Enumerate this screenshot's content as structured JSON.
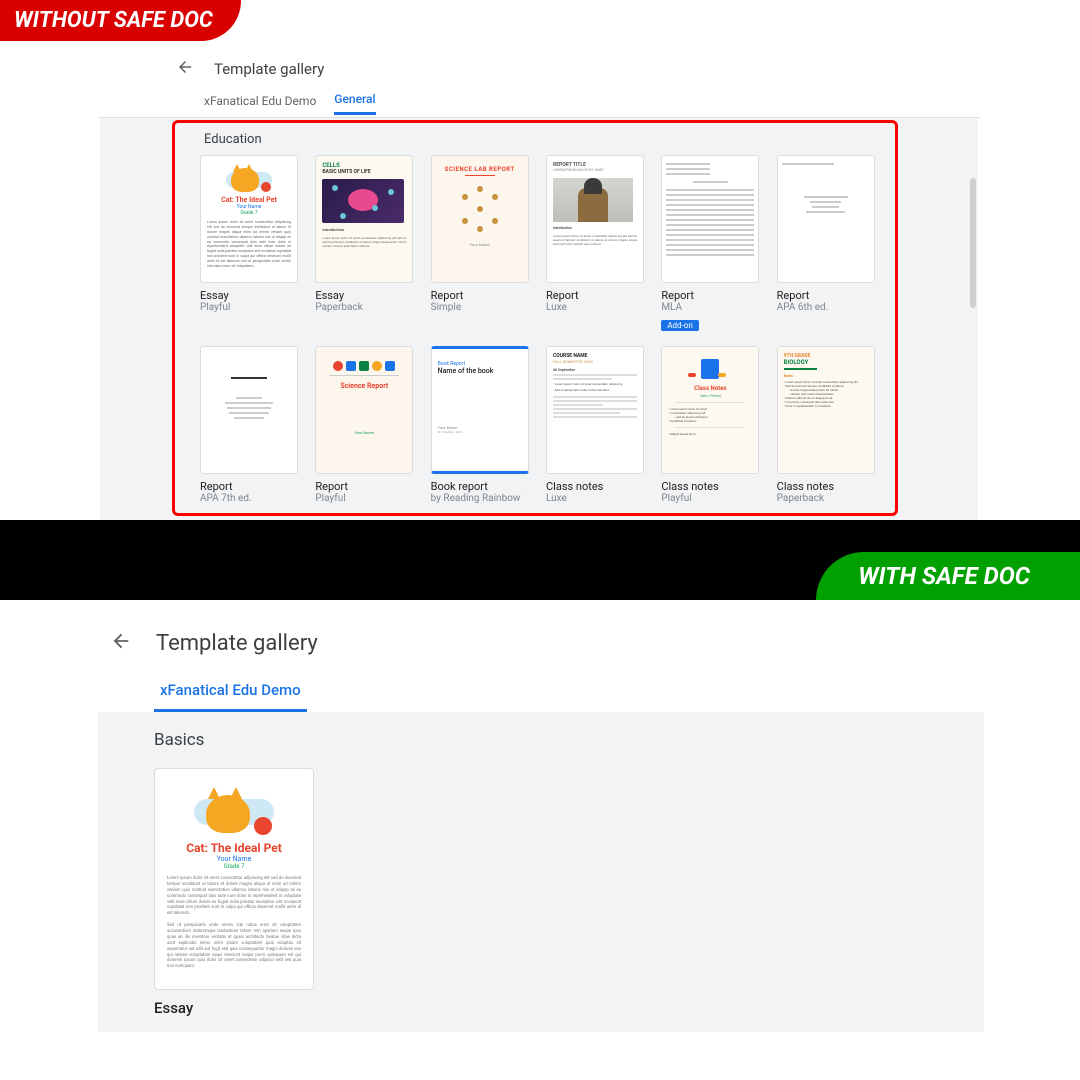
{
  "badges": {
    "without": "WITHOUT SAFE DOC",
    "with": "WITH SAFE DOC"
  },
  "top": {
    "title": "Template gallery",
    "tabs": [
      "xFanatical Edu Demo",
      "General"
    ],
    "active_tab": 1,
    "section": "Education",
    "templates": [
      {
        "title": "Essay",
        "sub": "Playful",
        "thumb_title": "Cat: The Ideal Pet",
        "thumb_sub1": "Your Name",
        "thumb_sub2": "Grade 7"
      },
      {
        "title": "Essay",
        "sub": "Paperback",
        "thumb_h1": "CELLS",
        "thumb_h2": "BASIC UNITS OF LIFE"
      },
      {
        "title": "Report",
        "sub": "Simple",
        "thumb_title": "SCIENCE LAB REPORT",
        "thumb_foot": "Your Name"
      },
      {
        "title": "Report",
        "sub": "Luxe",
        "thumb_h1": "REPORT TITLE",
        "thumb_h2": "LOREM IPSUM DOLOR SIT AMET"
      },
      {
        "title": "Report",
        "sub": "MLA",
        "addon": "Add-on"
      },
      {
        "title": "Report",
        "sub": "APA 6th ed."
      },
      {
        "title": "Report",
        "sub": "APA 7th ed."
      },
      {
        "title": "Report",
        "sub": "Playful",
        "thumb_title": "Science Report",
        "thumb_foot": "Your Name"
      },
      {
        "title": "Book report",
        "sub": "by Reading Rainbow",
        "thumb_h1": "Book Report",
        "thumb_h2": "Name of the book"
      },
      {
        "title": "Class notes",
        "sub": "Luxe",
        "thumb_h1": "COURSE NAME",
        "thumb_h2": "FALL SEMESTER 20XX"
      },
      {
        "title": "Class notes",
        "sub": "Playful",
        "thumb_title": "Class Notes"
      },
      {
        "title": "Class notes",
        "sub": "Paperback",
        "thumb_h1": "9TH GRADE",
        "thumb_h2": "BIOLOGY"
      }
    ]
  },
  "bottom": {
    "title": "Template gallery",
    "tabs": [
      "xFanatical Edu Demo"
    ],
    "active_tab": 0,
    "section": "Basics",
    "template": {
      "title": "Essay",
      "thumb_title": "Cat: The Ideal Pet",
      "thumb_name": "Your Name",
      "thumb_grade": "Grade 7"
    }
  }
}
